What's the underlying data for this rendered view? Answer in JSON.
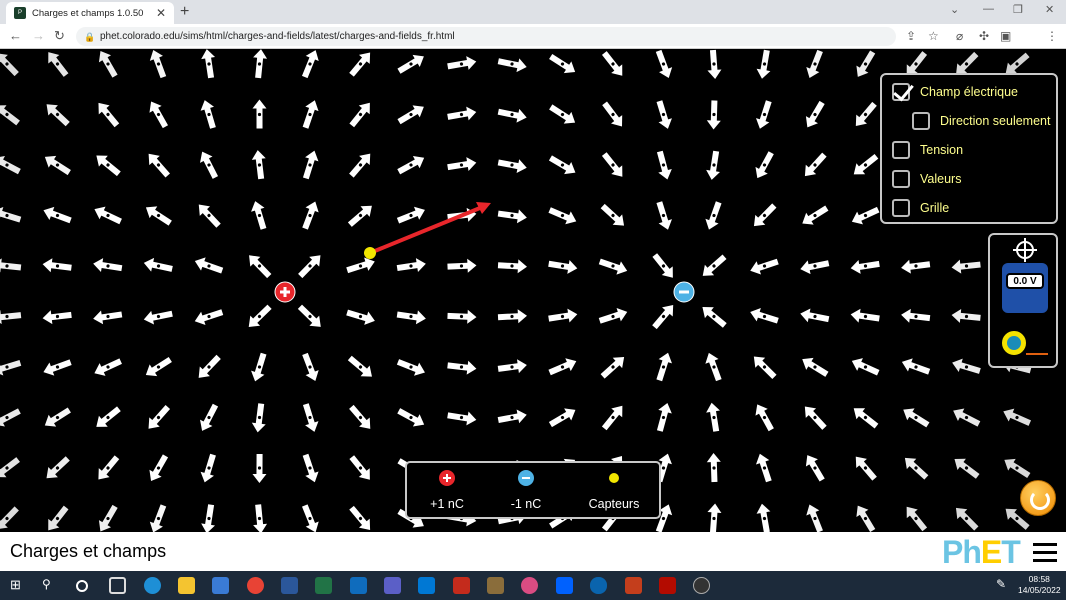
{
  "browser": {
    "tab_title": "Charges et champs 1.0.50",
    "tab_close": "✕",
    "new_tab": "+",
    "url": "phet.colorado.edu/sims/html/charges-and-fields/latest/charges-and-fields_fr.html",
    "avatar_letter": "T"
  },
  "controls": {
    "champ_electrique": "Champ électrique",
    "direction_seulement": "Direction seulement",
    "tension": "Tension",
    "valeurs": "Valeurs",
    "grille": "Grille",
    "champ_electrique_checked": true,
    "direction_seulement_checked": false,
    "tension_checked": false,
    "valeurs_checked": false,
    "grille_checked": false
  },
  "tools": {
    "voltmeter_reading": "0.0 V"
  },
  "charges_box": {
    "positive_label": "+1 nC",
    "negative_label": "-1 nC",
    "sensors_label": "Capteurs"
  },
  "footer": {
    "sim_title": "Charges et champs",
    "logo": "PhET"
  },
  "taskbar": {
    "time": "08:58",
    "date": "14/05/2022"
  },
  "colors": {
    "positive": "#e8262b",
    "negative": "#4eb2e5",
    "sensor": "#f2e600",
    "panel_text": "#ffff8e",
    "sensor_vector": "#e8262b"
  },
  "scene": {
    "positive_charge_nc": 1,
    "negative_charge_nc": -1,
    "sensor_count": 1
  }
}
